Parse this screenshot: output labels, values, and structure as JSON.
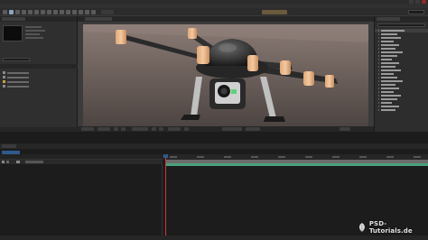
{
  "window": {
    "title": ""
  },
  "menu": {
    "items": [
      "",
      "",
      "",
      "",
      "",
      "",
      "",
      "",
      ""
    ]
  },
  "workspaces": {
    "items": [
      "",
      "",
      "",
      "",
      ""
    ],
    "active": 0
  },
  "project_panel": {
    "tab": "",
    "items": [
      "",
      "",
      "",
      ""
    ]
  },
  "composition": {
    "tab": ""
  },
  "effects_panel": {
    "tab": "",
    "categories": [
      "",
      "",
      "",
      "",
      "",
      "",
      "",
      "",
      "",
      "",
      "",
      "",
      "",
      "",
      "",
      "",
      "",
      "",
      "",
      "",
      "",
      "",
      ""
    ]
  },
  "timeline": {
    "tab": "",
    "current_time": "",
    "layer_name": "",
    "footer_label": ""
  },
  "colors": {
    "accent_blue": "#2e5a8c",
    "track_green": "#4aa17c",
    "playhead_red": "#d8343a",
    "workspace_active": "#6b5a3c"
  },
  "watermark": {
    "text": "PSD-Tutorials.de"
  }
}
